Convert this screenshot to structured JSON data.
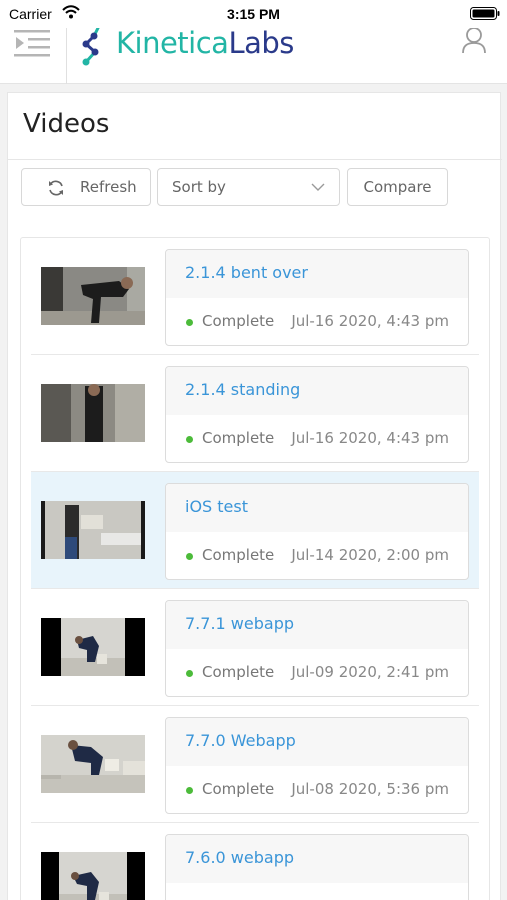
{
  "status_bar": {
    "carrier": "Carrier",
    "time": "3:15 PM"
  },
  "header": {
    "menu_icon": "menu-collapse-icon",
    "logo_part1": "Kinetica",
    "logo_part2": "Labs",
    "user_icon": "user-icon",
    "colors": {
      "teal": "#22b5a5",
      "navy": "#2a3a8a"
    }
  },
  "page": {
    "title": "Videos"
  },
  "toolbar": {
    "refresh_label": "Refresh",
    "refresh_icon": "refresh-icon",
    "sort_placeholder": "Sort by",
    "compare_label": "Compare"
  },
  "videos": [
    {
      "title": "2.1.4 bent over",
      "status": "Complete",
      "date": "Jul-16 2020, 4:43 pm"
    },
    {
      "title": "2.1.4 standing",
      "status": "Complete",
      "date": "Jul-16 2020, 4:43 pm"
    },
    {
      "title": "iOS test",
      "status": "Complete",
      "date": "Jul-14 2020, 2:00 pm",
      "selected": true
    },
    {
      "title": "7.7.1 webapp",
      "status": "Complete",
      "date": "Jul-09 2020, 2:41 pm"
    },
    {
      "title": "7.7.0 Webapp",
      "status": "Complete",
      "date": "Jul-08 2020, 5:36 pm"
    },
    {
      "title": "7.6.0 webapp",
      "status": "",
      "date": ""
    }
  ],
  "colors": {
    "link": "#3a95d8",
    "status_complete": "#4cbb3a",
    "selected_row": "#e8f4fb"
  }
}
